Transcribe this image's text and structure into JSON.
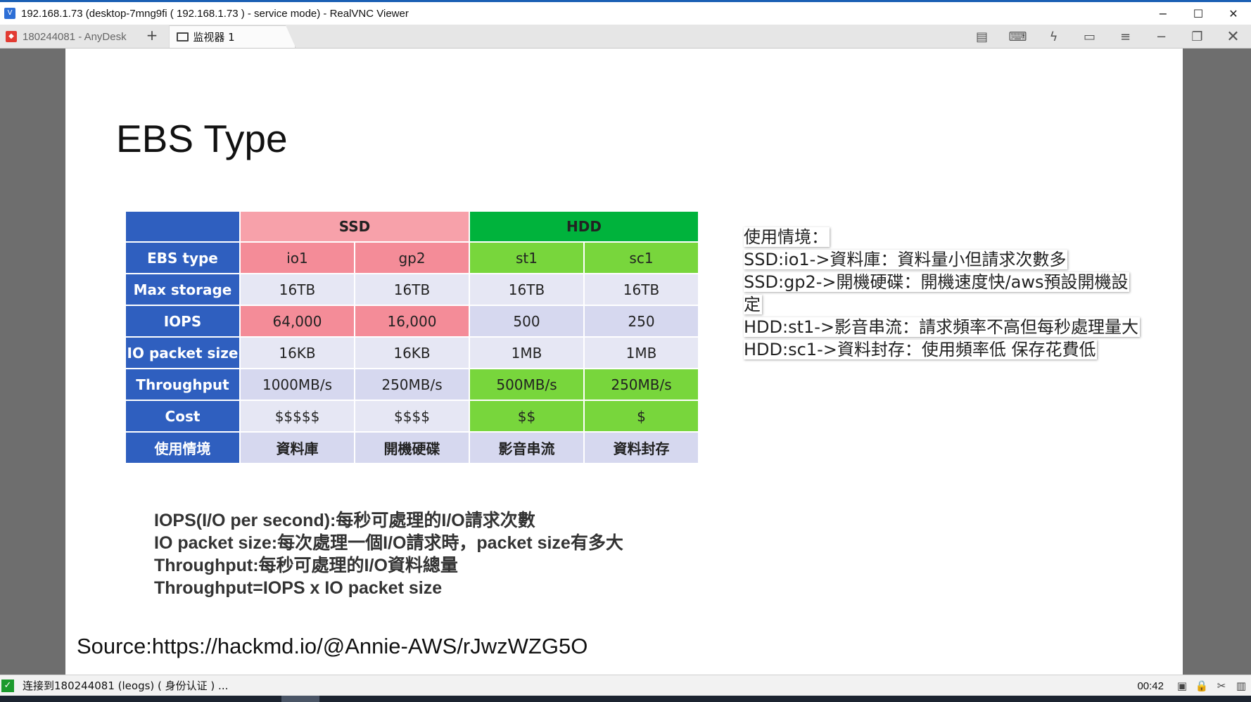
{
  "window": {
    "title": "192.168.1.73 (desktop-7mng9fi ( 192.168.1.73 ) - service mode) - RealVNC Viewer",
    "minimize": "−",
    "maximize": "☐",
    "close": "✕"
  },
  "anydesk": {
    "session_label": "180244081 - AnyDesk",
    "add_label": "+",
    "tab_label": "监视器 1"
  },
  "slide": {
    "title": "EBS Type",
    "table": {
      "group_headers": [
        "SSD",
        "HDD"
      ],
      "rows": [
        {
          "label": "EBS type",
          "cells": [
            "io1",
            "gp2",
            "st1",
            "sc1"
          ]
        },
        {
          "label": "Max storage",
          "cells": [
            "16TB",
            "16TB",
            "16TB",
            "16TB"
          ]
        },
        {
          "label": "IOPS",
          "cells": [
            "64,000",
            "16,000",
            "500",
            "250"
          ]
        },
        {
          "label": "IO packet size",
          "cells": [
            "16KB",
            "16KB",
            "1MB",
            "1MB"
          ]
        },
        {
          "label": "Throughput",
          "cells": [
            "1000MB/s",
            "250MB/s",
            "500MB/s",
            "250MB/s"
          ]
        },
        {
          "label": "Cost",
          "cells": [
            "$$$$$",
            "$$$$",
            "$$",
            "$"
          ]
        },
        {
          "label": "使用情境",
          "cells": [
            "資料庫",
            "開機硬碟",
            "影音串流",
            "資料封存"
          ]
        }
      ]
    },
    "usage": [
      "使用情境：",
      "SSD:io1->資料庫：資料量小但請求次數多",
      "SSD:gp2->開機硬碟：開機速度快/aws預設開機設",
      "定",
      "HDD:st1->影音串流：請求頻率不高但每秒處理量大",
      "HDD:sc1->資料封存：使用頻率低 保存花費低"
    ],
    "definitions": [
      "IOPS(I/O per second):每秒可處理的I/O請求次數",
      "IO packet size:每次處理一個I/O請求時，packet size有多大",
      "Throughput:每秒可處理的I/O資料總量",
      "Throughput=IOPS x IO packet size"
    ],
    "source": "Source:https://hackmd.io/@Annie-AWS/rJwzWZG5O"
  },
  "status": {
    "connection_text": "连接到180244081 (leogs) ( 身份认证 ) ...",
    "timer": "00:42"
  }
}
